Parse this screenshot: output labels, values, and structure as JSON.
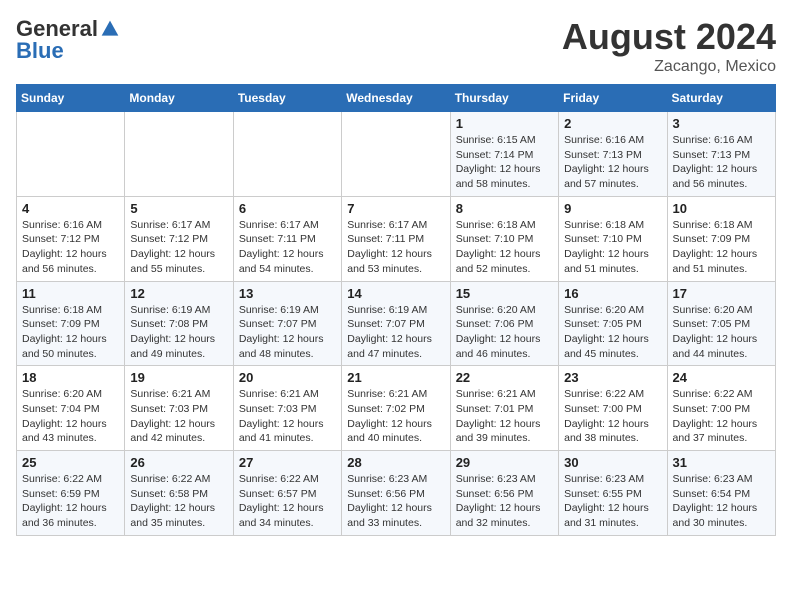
{
  "header": {
    "logo_general": "General",
    "logo_blue": "Blue",
    "month_title": "August 2024",
    "location": "Zacango, Mexico"
  },
  "days_of_week": [
    "Sunday",
    "Monday",
    "Tuesday",
    "Wednesday",
    "Thursday",
    "Friday",
    "Saturday"
  ],
  "weeks": [
    [
      {
        "day": "",
        "info": ""
      },
      {
        "day": "",
        "info": ""
      },
      {
        "day": "",
        "info": ""
      },
      {
        "day": "",
        "info": ""
      },
      {
        "day": "1",
        "info": "Sunrise: 6:15 AM\nSunset: 7:14 PM\nDaylight: 12 hours\nand 58 minutes."
      },
      {
        "day": "2",
        "info": "Sunrise: 6:16 AM\nSunset: 7:13 PM\nDaylight: 12 hours\nand 57 minutes."
      },
      {
        "day": "3",
        "info": "Sunrise: 6:16 AM\nSunset: 7:13 PM\nDaylight: 12 hours\nand 56 minutes."
      }
    ],
    [
      {
        "day": "4",
        "info": "Sunrise: 6:16 AM\nSunset: 7:12 PM\nDaylight: 12 hours\nand 56 minutes."
      },
      {
        "day": "5",
        "info": "Sunrise: 6:17 AM\nSunset: 7:12 PM\nDaylight: 12 hours\nand 55 minutes."
      },
      {
        "day": "6",
        "info": "Sunrise: 6:17 AM\nSunset: 7:11 PM\nDaylight: 12 hours\nand 54 minutes."
      },
      {
        "day": "7",
        "info": "Sunrise: 6:17 AM\nSunset: 7:11 PM\nDaylight: 12 hours\nand 53 minutes."
      },
      {
        "day": "8",
        "info": "Sunrise: 6:18 AM\nSunset: 7:10 PM\nDaylight: 12 hours\nand 52 minutes."
      },
      {
        "day": "9",
        "info": "Sunrise: 6:18 AM\nSunset: 7:10 PM\nDaylight: 12 hours\nand 51 minutes."
      },
      {
        "day": "10",
        "info": "Sunrise: 6:18 AM\nSunset: 7:09 PM\nDaylight: 12 hours\nand 51 minutes."
      }
    ],
    [
      {
        "day": "11",
        "info": "Sunrise: 6:18 AM\nSunset: 7:09 PM\nDaylight: 12 hours\nand 50 minutes."
      },
      {
        "day": "12",
        "info": "Sunrise: 6:19 AM\nSunset: 7:08 PM\nDaylight: 12 hours\nand 49 minutes."
      },
      {
        "day": "13",
        "info": "Sunrise: 6:19 AM\nSunset: 7:07 PM\nDaylight: 12 hours\nand 48 minutes."
      },
      {
        "day": "14",
        "info": "Sunrise: 6:19 AM\nSunset: 7:07 PM\nDaylight: 12 hours\nand 47 minutes."
      },
      {
        "day": "15",
        "info": "Sunrise: 6:20 AM\nSunset: 7:06 PM\nDaylight: 12 hours\nand 46 minutes."
      },
      {
        "day": "16",
        "info": "Sunrise: 6:20 AM\nSunset: 7:05 PM\nDaylight: 12 hours\nand 45 minutes."
      },
      {
        "day": "17",
        "info": "Sunrise: 6:20 AM\nSunset: 7:05 PM\nDaylight: 12 hours\nand 44 minutes."
      }
    ],
    [
      {
        "day": "18",
        "info": "Sunrise: 6:20 AM\nSunset: 7:04 PM\nDaylight: 12 hours\nand 43 minutes."
      },
      {
        "day": "19",
        "info": "Sunrise: 6:21 AM\nSunset: 7:03 PM\nDaylight: 12 hours\nand 42 minutes."
      },
      {
        "day": "20",
        "info": "Sunrise: 6:21 AM\nSunset: 7:03 PM\nDaylight: 12 hours\nand 41 minutes."
      },
      {
        "day": "21",
        "info": "Sunrise: 6:21 AM\nSunset: 7:02 PM\nDaylight: 12 hours\nand 40 minutes."
      },
      {
        "day": "22",
        "info": "Sunrise: 6:21 AM\nSunset: 7:01 PM\nDaylight: 12 hours\nand 39 minutes."
      },
      {
        "day": "23",
        "info": "Sunrise: 6:22 AM\nSunset: 7:00 PM\nDaylight: 12 hours\nand 38 minutes."
      },
      {
        "day": "24",
        "info": "Sunrise: 6:22 AM\nSunset: 7:00 PM\nDaylight: 12 hours\nand 37 minutes."
      }
    ],
    [
      {
        "day": "25",
        "info": "Sunrise: 6:22 AM\nSunset: 6:59 PM\nDaylight: 12 hours\nand 36 minutes."
      },
      {
        "day": "26",
        "info": "Sunrise: 6:22 AM\nSunset: 6:58 PM\nDaylight: 12 hours\nand 35 minutes."
      },
      {
        "day": "27",
        "info": "Sunrise: 6:22 AM\nSunset: 6:57 PM\nDaylight: 12 hours\nand 34 minutes."
      },
      {
        "day": "28",
        "info": "Sunrise: 6:23 AM\nSunset: 6:56 PM\nDaylight: 12 hours\nand 33 minutes."
      },
      {
        "day": "29",
        "info": "Sunrise: 6:23 AM\nSunset: 6:56 PM\nDaylight: 12 hours\nand 32 minutes."
      },
      {
        "day": "30",
        "info": "Sunrise: 6:23 AM\nSunset: 6:55 PM\nDaylight: 12 hours\nand 31 minutes."
      },
      {
        "day": "31",
        "info": "Sunrise: 6:23 AM\nSunset: 6:54 PM\nDaylight: 12 hours\nand 30 minutes."
      }
    ]
  ]
}
